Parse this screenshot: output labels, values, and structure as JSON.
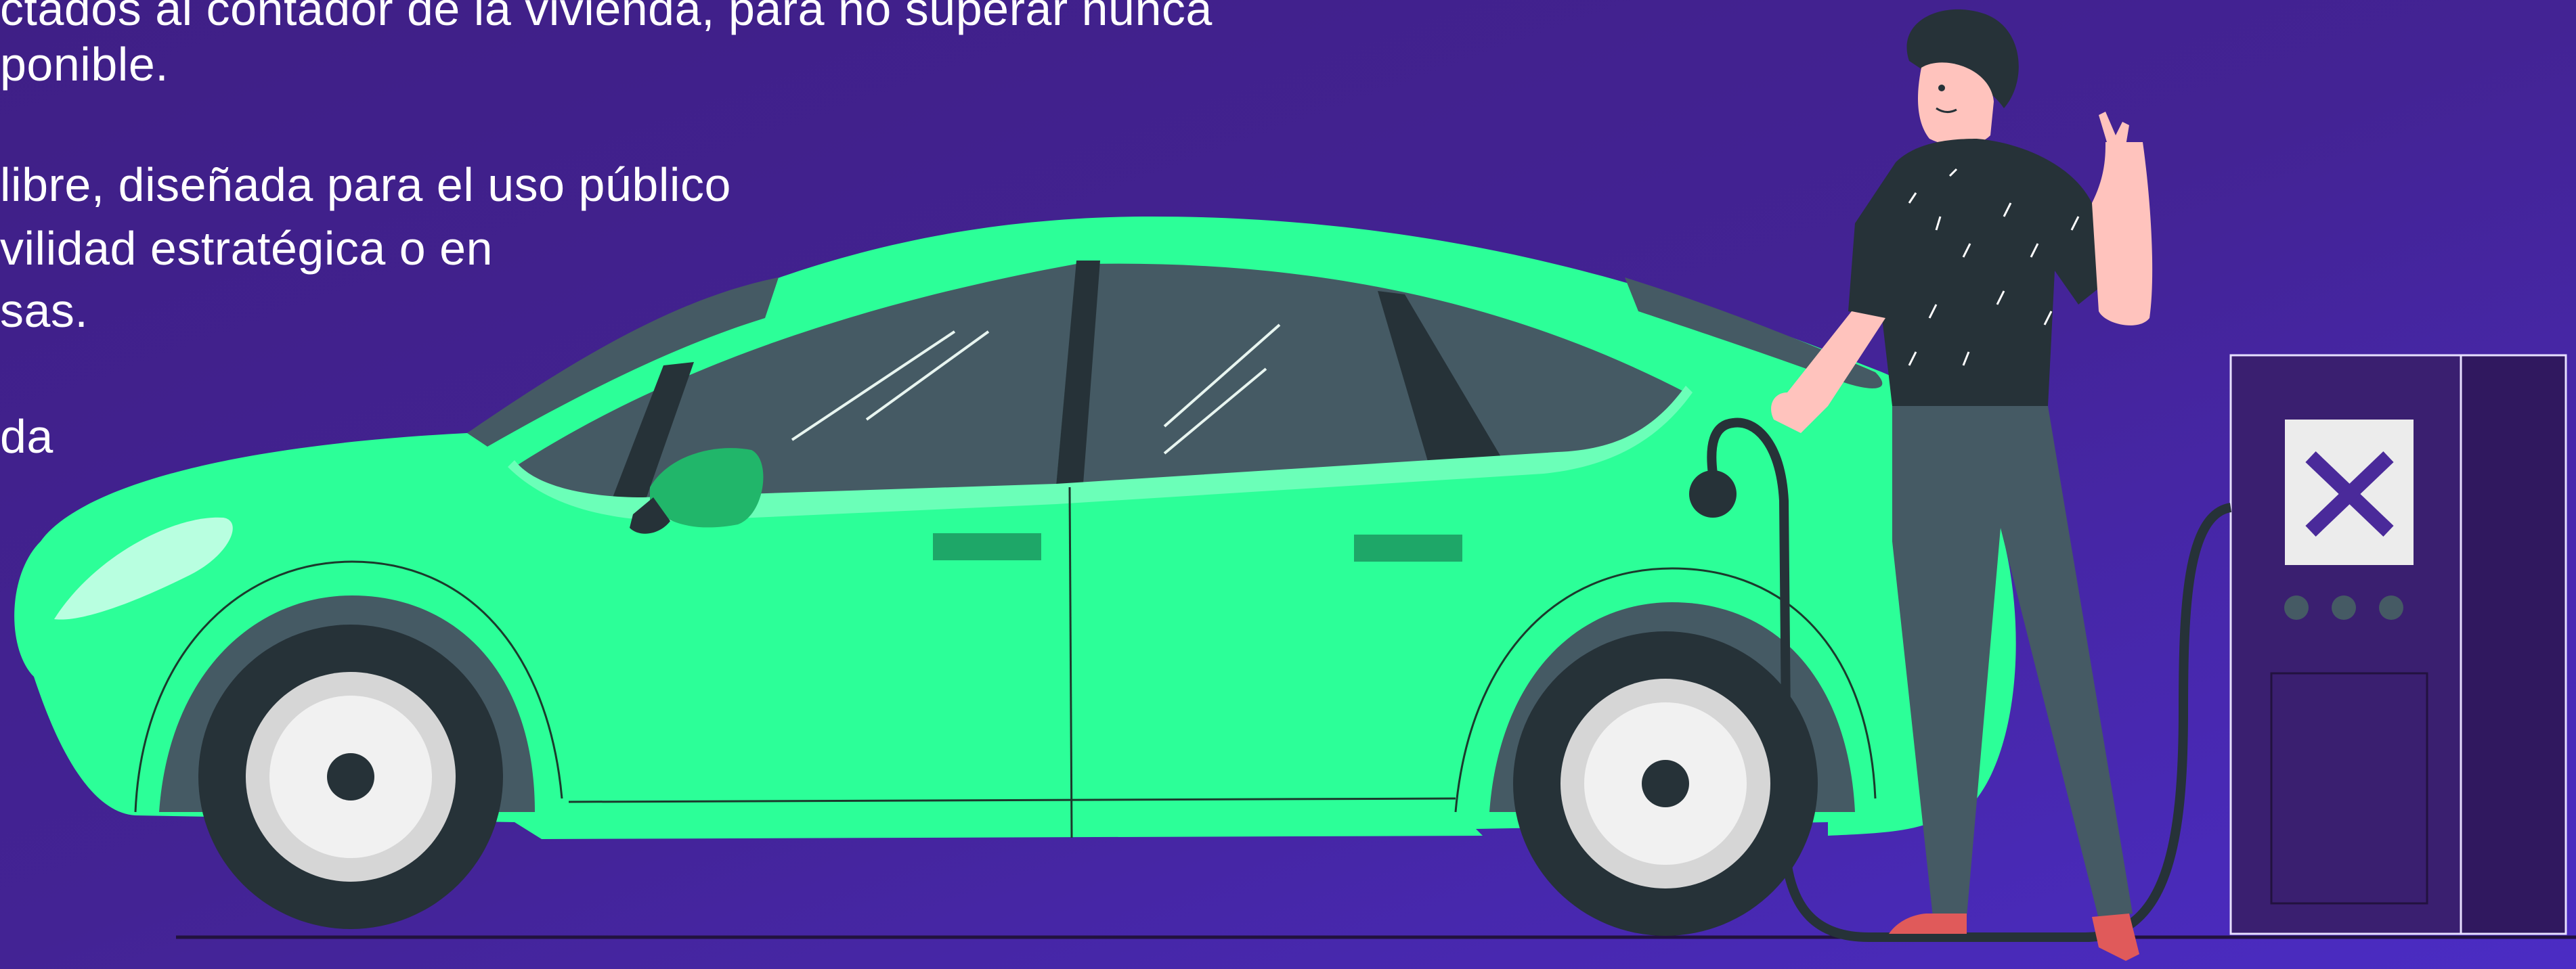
{
  "description_text": {
    "line1": "ctados al contador de la vivienda, para no superar nunca",
    "line2": "ponible.",
    "line3": "libre, diseñada para el uso público",
    "line4": "vilidad estratégica o en",
    "line5": "sas.",
    "line6": "da"
  },
  "colors": {
    "background_top": "#3f1f86",
    "background_bottom": "#4b2cc4",
    "car_body": "#2cff98",
    "window": "#455a64",
    "tire": "#263238",
    "charger_panel": "#3a1f70",
    "charger_logo": "#4a2a9a"
  },
  "illustration": {
    "subject": "electric car charging at a public charging station with a person holding the charging cable",
    "icons": [
      "car",
      "person",
      "charging-station",
      "charging-cable",
      "x-logo"
    ]
  }
}
